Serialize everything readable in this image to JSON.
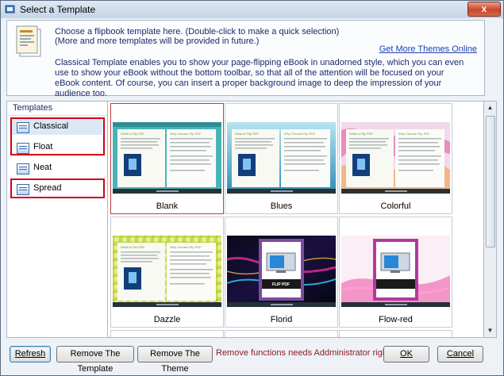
{
  "window": {
    "title": "Select a Template",
    "close_label": "x"
  },
  "info": {
    "line1": "Choose a flipbook template here. (Double-click to make a quick selection)",
    "line2": "(More and more templates will be provided in future.)",
    "link": "Get More Themes Online",
    "description": "Classical Template enables you to show your page-flipping eBook in unadorned style, which you can even use to show your eBook without the bottom toolbar, so that all of the attention will be focused on your eBook content. Of course, you can insert a proper background image to deep the impression of your audience too."
  },
  "sidebar": {
    "header": "Templates",
    "items": [
      {
        "label": "Classical",
        "selected": true,
        "highlighted": true
      },
      {
        "label": "Float",
        "selected": false,
        "highlighted": true
      },
      {
        "label": "Neat",
        "selected": false,
        "highlighted": false
      },
      {
        "label": "Spread",
        "selected": false,
        "highlighted": true
      }
    ]
  },
  "templates": [
    {
      "name": "Blank",
      "selected": true,
      "style": "teal",
      "page_title": "What is Flip PDF",
      "page_title_right": "Why Choose Flip PDF"
    },
    {
      "name": "Blues",
      "selected": false,
      "style": "blue",
      "page_title": "What is Flip PDF",
      "page_title_right": "Why Choose Flip PDF"
    },
    {
      "name": "Colorful",
      "selected": false,
      "style": "colorful",
      "page_title": "What is Flip PDF",
      "page_title_right": "Why Choose Flip PDF"
    },
    {
      "name": "Dazzle",
      "selected": false,
      "style": "dazzle",
      "page_title": "What is Flip PDF",
      "page_title_right": "Why Choose Flip PDF"
    },
    {
      "name": "Florid",
      "selected": false,
      "style": "florid",
      "cover_text": "FLIP PDF"
    },
    {
      "name": "Flow-red",
      "selected": false,
      "style": "flowred"
    }
  ],
  "buttons": {
    "refresh": "Refresh",
    "remove_template": "Remove The Template",
    "remove_theme": "Remove The Theme",
    "ok": "OK",
    "cancel": "Cancel"
  },
  "warning": "Remove functions needs Addministrator rights!",
  "colors": {
    "accent_red": "#d3001a",
    "warning_text": "#8b1a1a",
    "link": "#1b3fb0",
    "info_text": "#1a2a6b"
  }
}
